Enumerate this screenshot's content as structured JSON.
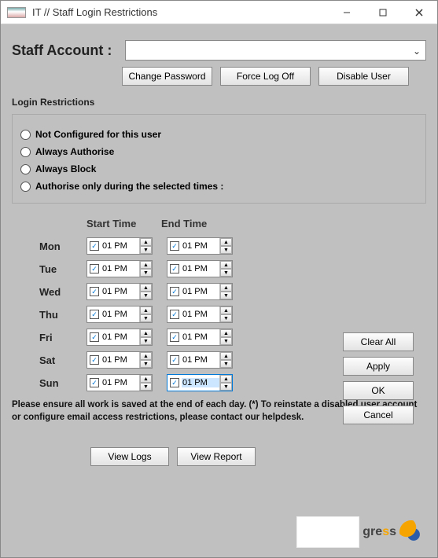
{
  "window": {
    "title": "IT // Staff Login Restrictions"
  },
  "account": {
    "label": "Staff Account :",
    "value": ""
  },
  "buttons": {
    "change_password": "Change Password",
    "force_logoff": "Force Log Off",
    "disable_user": "Disable User",
    "clear_all": "Clear All",
    "apply": "Apply",
    "ok": "OK",
    "cancel": "Cancel",
    "view_logs": "View Logs",
    "view_report": "View Report"
  },
  "sections": {
    "restrictions_title": "Login Restrictions"
  },
  "radios": {
    "not_configured": "Not Configured for this user",
    "always_authorise": "Always Authorise",
    "always_block": "Always Block",
    "authorise_times": "Authorise only during the selected times :"
  },
  "time_table": {
    "start_header": "Start Time",
    "end_header": "End Time",
    "days": [
      {
        "label": "Mon",
        "start": "01 PM",
        "end": "01 PM"
      },
      {
        "label": "Tue",
        "start": "01 PM",
        "end": "01 PM"
      },
      {
        "label": "Wed",
        "start": "01 PM",
        "end": "01 PM"
      },
      {
        "label": "Thu",
        "start": "01 PM",
        "end": "01 PM"
      },
      {
        "label": "Fri",
        "start": "01 PM",
        "end": "01 PM"
      },
      {
        "label": "Sat",
        "start": "01 PM",
        "end": "01 PM"
      },
      {
        "label": "Sun",
        "start": "01 PM",
        "end": "01 PM"
      }
    ]
  },
  "footer": {
    "text": "Please ensure all work is saved at the end of each day. (*) To reinstate a disabled user account or configure email access restrictions, please contact our helpdesk."
  },
  "logo": {
    "text_prefix": "gre",
    "text_highlight": "s",
    "text_suffix": "s"
  }
}
